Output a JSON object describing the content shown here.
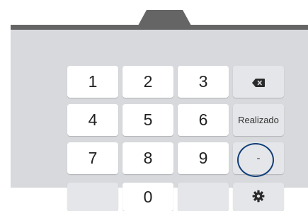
{
  "keyboard": {
    "keys": {
      "k1": "1",
      "k2": "2",
      "k3": "3",
      "k4": "4",
      "k5": "5",
      "k6": "6",
      "k7": "7",
      "k8": "8",
      "k9": "9",
      "k0": "0",
      "done": "Realizado",
      "dash": "-"
    },
    "icons": {
      "backspace": "backspace-icon",
      "settings": "gear-icon"
    }
  },
  "colors": {
    "frame": "#656565",
    "keyboard_bg": "#d7d9dc",
    "key_bg": "#ffffff",
    "func_key_bg": "#e4e6e9",
    "highlight": "#123f78"
  }
}
